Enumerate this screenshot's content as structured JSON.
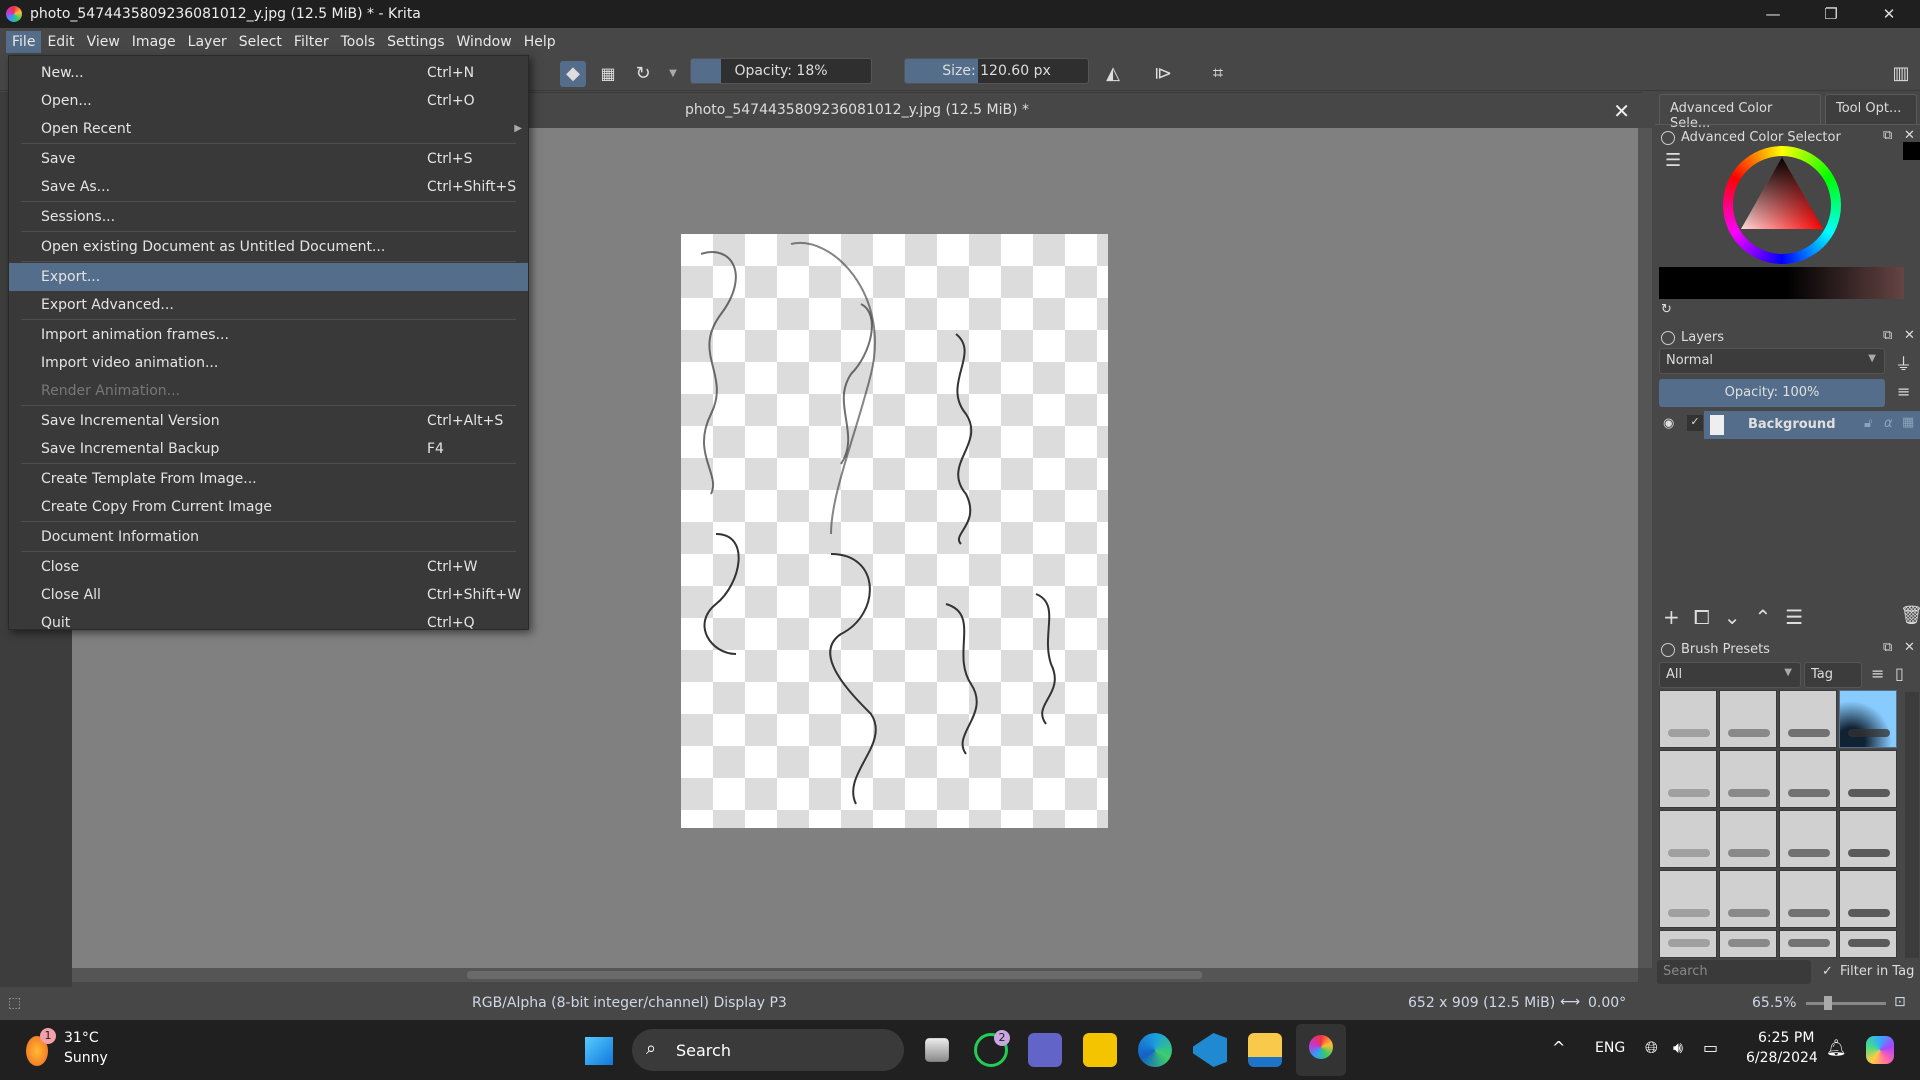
{
  "window": {
    "title": "photo_5474435809236081012_y.jpg (12.5 MiB) * - Krita",
    "minimize": "—",
    "restore": "❐",
    "close": "✕"
  },
  "menubar": [
    "File",
    "Edit",
    "View",
    "Image",
    "Layer",
    "Select",
    "Filter",
    "Tools",
    "Settings",
    "Window",
    "Help"
  ],
  "file_menu": {
    "groups": [
      [
        {
          "label": "New...",
          "shortcut": "Ctrl+N"
        },
        {
          "label": "Open...",
          "shortcut": "Ctrl+O"
        },
        {
          "label": "Open Recent",
          "submenu": true
        }
      ],
      [
        {
          "label": "Save",
          "shortcut": "Ctrl+S"
        },
        {
          "label": "Save As...",
          "shortcut": "Ctrl+Shift+S"
        }
      ],
      [
        {
          "label": "Sessions..."
        }
      ],
      [
        {
          "label": "Open existing Document as Untitled Document..."
        }
      ],
      [
        {
          "label": "Export...",
          "highlighted": true
        },
        {
          "label": "Export Advanced..."
        }
      ],
      [
        {
          "label": "Import animation frames..."
        },
        {
          "label": "Import video animation..."
        },
        {
          "label": "Render Animation...",
          "disabled": true
        }
      ],
      [
        {
          "label": "Save Incremental Version",
          "shortcut": "Ctrl+Alt+S"
        },
        {
          "label": "Save Incremental Backup",
          "shortcut": "F4"
        }
      ],
      [
        {
          "label": "Create Template From Image..."
        },
        {
          "label": "Create Copy From Current Image"
        }
      ],
      [
        {
          "label": "Document Information"
        }
      ],
      [
        {
          "label": "Close",
          "shortcut": "Ctrl+W"
        },
        {
          "label": "Close All",
          "shortcut": "Ctrl+Shift+W"
        },
        {
          "label": "Quit",
          "shortcut": "Ctrl+Q"
        }
      ]
    ]
  },
  "toolbar": {
    "opacity_label": "Opacity: 18%",
    "opacity_value": 18,
    "size_label": "Size: 120.60 px",
    "size_fraction": 0.4,
    "icons": [
      "eraser-icon",
      "alpha-lock-icon",
      "reload-preset-icon",
      "mirror-horizontal-icon",
      "mirror-vertical-icon",
      "wrap-around-icon",
      "workspace-icon"
    ]
  },
  "document": {
    "tab_title": "photo_5474435809236081012_y.jpg (12.5 MiB) *",
    "close": "✕"
  },
  "right_panel": {
    "tabs": [
      "Advanced Color Sele...",
      "Tool Opt..."
    ],
    "color_selector": {
      "title": "Advanced Color Selector",
      "hue_color": "#ff0000"
    },
    "layers": {
      "title": "Layers",
      "blend_mode": "Normal",
      "opacity_label": "Opacity:  100%",
      "layers": [
        {
          "name": "Background",
          "visible": true,
          "selected": true
        }
      ]
    },
    "brush_presets": {
      "title": "Brush Presets",
      "filter": "All",
      "tag": "Tag",
      "search_placeholder": "Search",
      "filter_in_tag": "Filter in Tag",
      "filter_in_tag_checked": true
    }
  },
  "statusbar": {
    "color_info": "RGB/Alpha (8-bit integer/channel)  Display P3",
    "image_size": "652 x 909 (12.5 MiB)",
    "rotation": "0.00°",
    "zoom": "65.5%"
  },
  "taskbar": {
    "weather": {
      "temp": "31°C",
      "condition": "Sunny",
      "badge": "1"
    },
    "search": "Search",
    "whatsapp_badge": "2",
    "language": "ENG",
    "time": "6:25 PM",
    "date": "6/28/2024"
  }
}
